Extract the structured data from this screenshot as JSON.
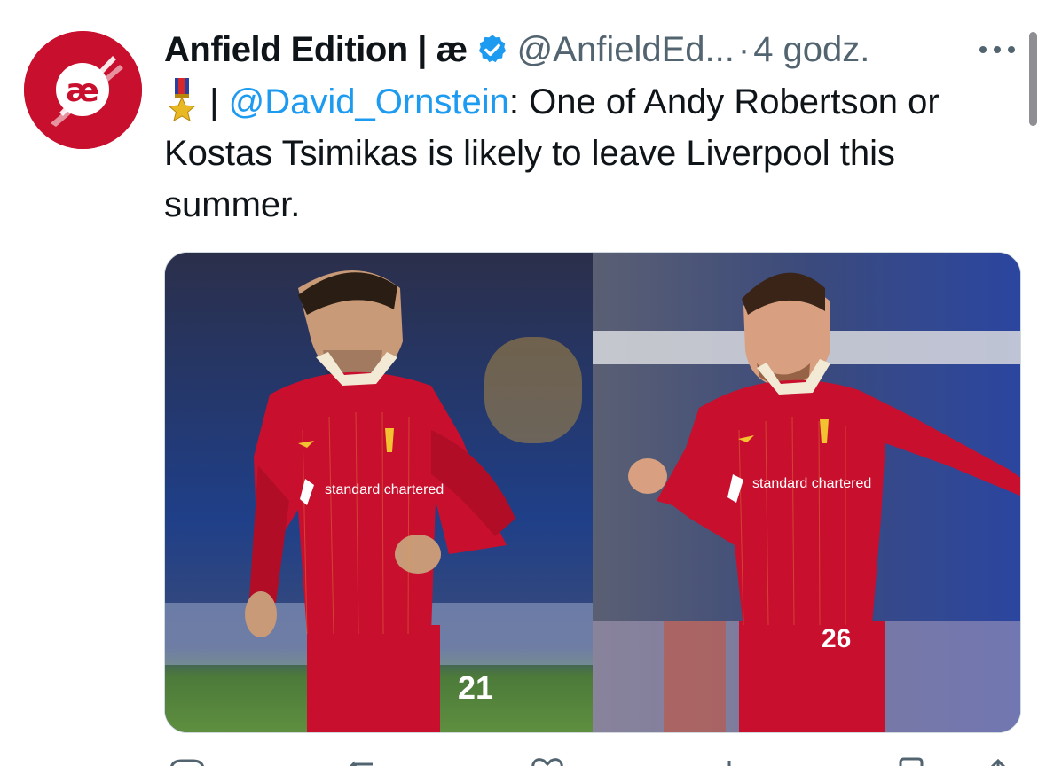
{
  "tweet": {
    "author_name": "Anfield Edition | æ",
    "handle": "@AnfieldEd...",
    "separator": "·",
    "time": "4 godz.",
    "avatar_label": "æ",
    "brand_color": "#c8102e",
    "verified_color": "#1d9bf0",
    "text_prefix_separator": " | ",
    "mention": "@David_Ornstein",
    "text_body": ": One of Andy Robertson or Kostas Tsimikas is likely to leave Liverpool this summer.",
    "media": [
      {
        "alt": "Kostas Tsimikas in Liverpool kit",
        "shirt_sponsor": "standard chartered",
        "shirt_number": "21"
      },
      {
        "alt": "Andy Robertson in Liverpool kit",
        "shirt_sponsor": "standard chartered",
        "shirt_number": "26"
      }
    ],
    "icons": [
      "verified-badge-icon",
      "medal-icon",
      "more-options-icon",
      "reply-icon",
      "retweet-icon",
      "like-icon",
      "views-icon",
      "bookmark-icon",
      "share-icon"
    ]
  }
}
